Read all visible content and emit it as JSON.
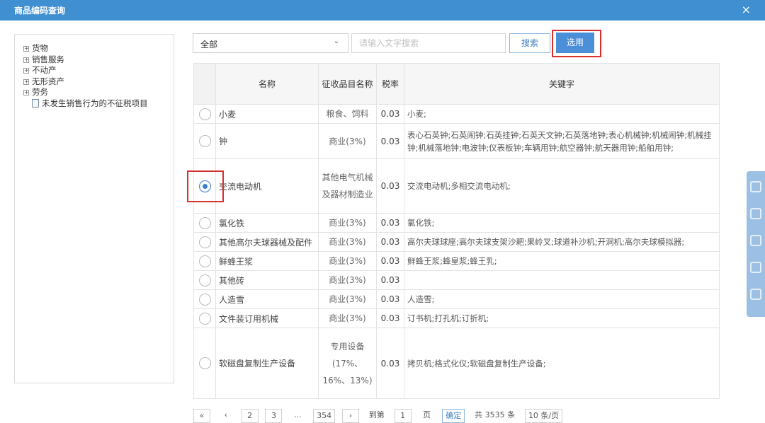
{
  "window": {
    "title": "商品编码查询",
    "close_label": "×"
  },
  "tree": {
    "nodes": [
      {
        "label": "货物",
        "toggle": "⊞"
      },
      {
        "label": "销售服务",
        "toggle": "⊞"
      },
      {
        "label": "不动产",
        "toggle": "⊞"
      },
      {
        "label": "无形资产",
        "toggle": "⊞"
      },
      {
        "label": "劳务",
        "toggle": "⊞"
      },
      {
        "label": "未发生销售行为的不征税项目",
        "toggle": ""
      }
    ]
  },
  "toolbar": {
    "filter_value": "全部",
    "filter_arrow": "⌄",
    "search_placeholder": "请输入文字搜索",
    "search_label": "搜索",
    "select_label": "选用"
  },
  "table": {
    "headers": {
      "name": "名称",
      "category": "征收品目名称",
      "rate": "税率",
      "keywords": "关键字"
    },
    "rows": [
      {
        "name": "小麦",
        "category": "粮食、饲料",
        "rate": "0.03",
        "keywords": "小麦;",
        "selected": false
      },
      {
        "name": "钟",
        "category": "商业(3%)",
        "rate": "0.03",
        "keywords": "表心石英钟;石英闹钟;石英挂钟;石英天文钟;石英落地钟;表心机械钟;机械闹钟;机械挂钟;机械落地钟;电波钟;仪表板钟;车辆用钟;航空器钟;航天器用钟;船舶用钟;",
        "selected": false
      },
      {
        "name": "交流电动机",
        "category": "其他电气机械及器材制造业",
        "rate": "0.03",
        "keywords": "交流电动机;多相交流电动机;",
        "selected": true
      },
      {
        "name": "氯化铁",
        "category": "商业(3%)",
        "rate": "0.03",
        "keywords": "氯化铁;",
        "selected": false
      },
      {
        "name": "其他高尔夫球器械及配件",
        "category": "商业(3%)",
        "rate": "0.03",
        "keywords": "高尔夫球球座;高尔夫球支架沙耙;果岭叉;球道补沙机;开洞机;高尔夫球模拟器;",
        "selected": false
      },
      {
        "name": "鲜蜂王浆",
        "category": "商业(3%)",
        "rate": "0.03",
        "keywords": "鲜蜂王浆;蜂皇浆;蜂王乳;",
        "selected": false
      },
      {
        "name": "其他砖",
        "category": "商业(3%)",
        "rate": "0.03",
        "keywords": "",
        "selected": false
      },
      {
        "name": "人造雪",
        "category": "商业(3%)",
        "rate": "0.03",
        "keywords": "人造雪;",
        "selected": false
      },
      {
        "name": "文件装订用机械",
        "category": "商业(3%)",
        "rate": "0.03",
        "keywords": "订书机;打孔机;订折机;",
        "selected": false
      },
      {
        "name": "软磁盘复制生产设备",
        "category": "专用设备(17%、16%、13%)",
        "rate": "0.03",
        "keywords": "拷贝机;格式化仪;软磁盘复制生产设备;",
        "selected": false
      }
    ]
  },
  "pager": {
    "first": "«",
    "prev": "‹",
    "page_2": "2",
    "page_3": "3",
    "ellipsis": "...",
    "page_last": "354",
    "next": "›",
    "goto_label": "到第",
    "page_input": "1",
    "page_unit": "页",
    "go_label": "确定",
    "total": "共 3535 条",
    "per_page": "10 条/页"
  },
  "colors": {
    "titlebar": "#3f8fd1",
    "primary_button": "#4a8fd8",
    "highlight_box": "#d8302c"
  }
}
